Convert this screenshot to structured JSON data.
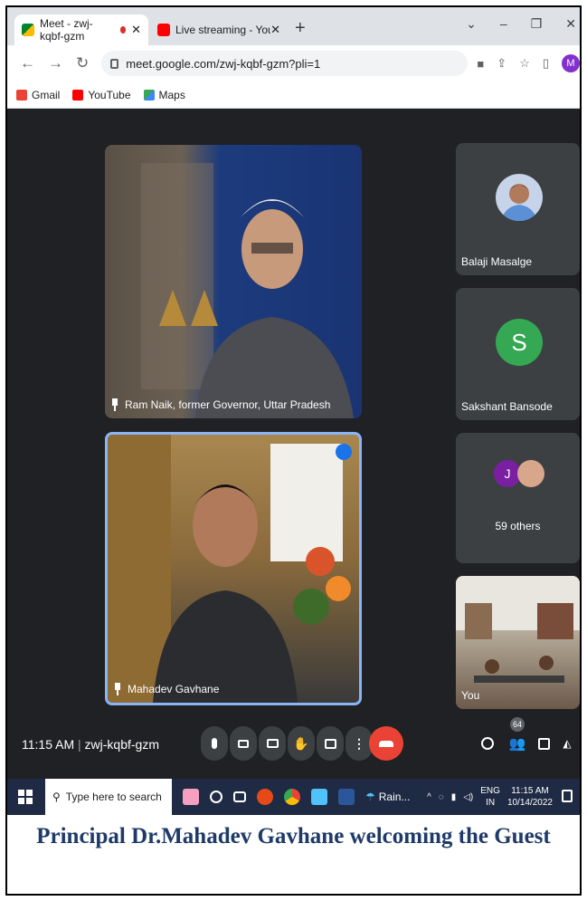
{
  "browser": {
    "tabs": [
      {
        "title": "Meet - zwj-kqbf-gzm",
        "favicon_color": "#00832d"
      },
      {
        "title": "Live streaming - YouTube Studio",
        "favicon_color": "#ff0000"
      }
    ],
    "url": "meet.google.com/zwj-kqbf-gzm?pli=1",
    "profile_initial": "M",
    "bookmarks": [
      {
        "label": "Gmail",
        "icon": "gmail-icon",
        "color": "#ea4335"
      },
      {
        "label": "YouTube",
        "icon": "youtube-icon",
        "color": "#ff0000"
      },
      {
        "label": "Maps",
        "icon": "maps-icon",
        "color": "#34a853"
      }
    ]
  },
  "meet": {
    "main_tiles": [
      {
        "name": "Ram Naik, former Governor, Uttar Pradesh"
      },
      {
        "name": "Mahadev Gavhane",
        "speaking": true
      }
    ],
    "side_tiles": [
      {
        "name": "Balaji Masalge",
        "muted": true
      },
      {
        "name": "Sakshant Bansode",
        "initial": "S",
        "avatar_color": "#34a853",
        "muted": true
      },
      {
        "name": "59 others",
        "initial": "J",
        "avatar_color": "#7b1fa2"
      },
      {
        "name": "You"
      }
    ],
    "time": "11:15 AM",
    "meeting_code": "zwj-kqbf-gzm",
    "participant_count": "64"
  },
  "taskbar": {
    "search_placeholder": "Type here to search",
    "weather": "Rain...",
    "language_top": "ENG",
    "language_bottom": "IN",
    "clock_time": "11:15 AM",
    "clock_date": "10/14/2022"
  },
  "caption": "Principal Dr.Mahadev Gavhane welcoming the Guest"
}
